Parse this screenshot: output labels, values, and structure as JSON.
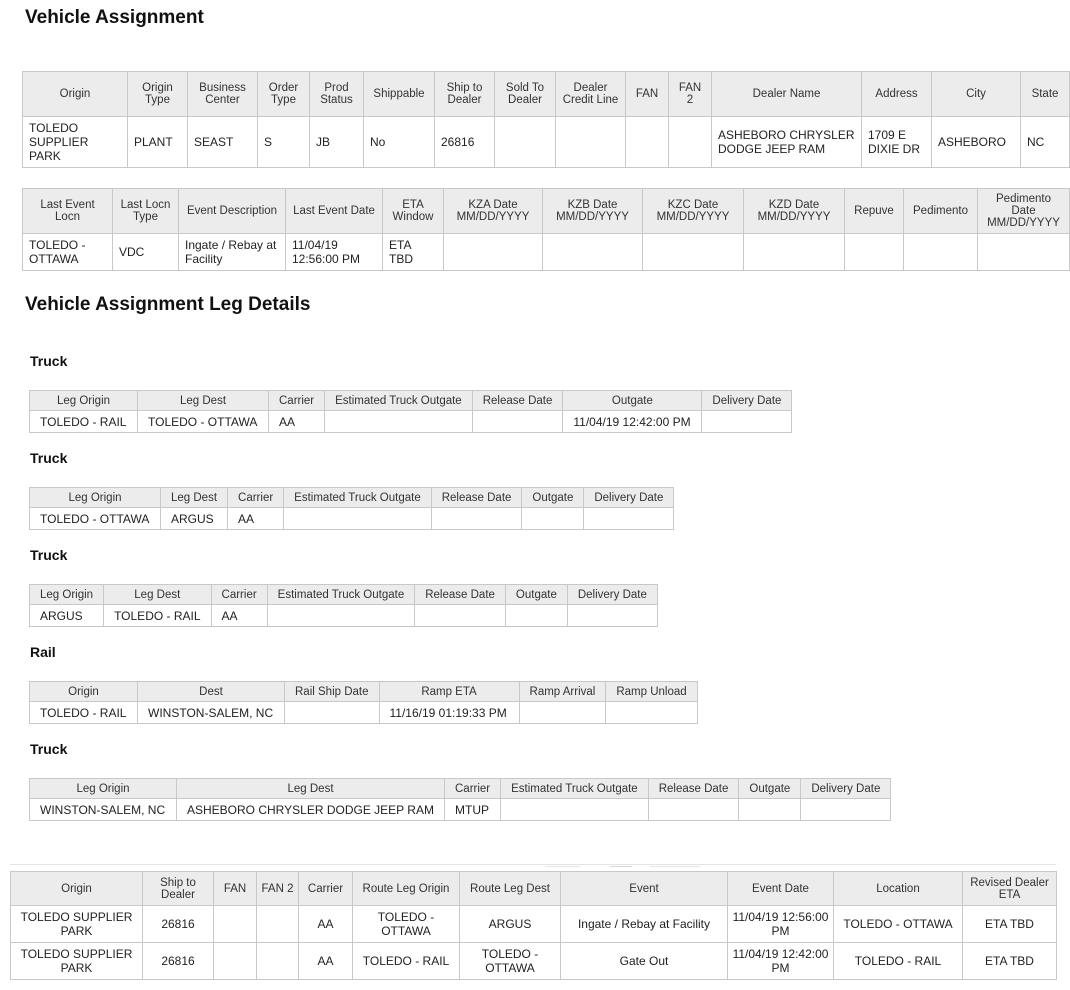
{
  "title": "Vehicle Assignment",
  "assignment": {
    "headers": [
      "Origin",
      "Origin Type",
      "Business Center",
      "Order Type",
      "Prod Status",
      "Shippable",
      "Ship to Dealer",
      "Sold To Dealer",
      "Dealer Credit Line",
      "FAN",
      "FAN 2",
      "Dealer Name",
      "Address",
      "City",
      "State"
    ],
    "row": [
      "TOLEDO SUPPLIER PARK",
      "PLANT",
      "SEAST",
      "S",
      "JB",
      "No",
      "26816",
      "",
      "",
      "",
      "",
      "ASHEBORO CHRYSLER DODGE JEEP RAM",
      "1709 E DIXIE DR",
      "ASHEBORO",
      "NC"
    ]
  },
  "event": {
    "headers": [
      "Last Event Locn",
      "Last Locn Type",
      "Event Description",
      "Last Event Date",
      "ETA Window",
      "KZA Date MM/DD/YYYY",
      "KZB Date MM/DD/YYYY",
      "KZC Date MM/DD/YYYY",
      "KZD Date MM/DD/YYYY",
      "Repuve",
      "Pedimento",
      "Pedimento Date MM/DD/YYYY"
    ],
    "row": [
      "TOLEDO - OTTAWA",
      "VDC",
      "Ingate / Rebay at Facility",
      "11/04/19 12:56:00 PM",
      "ETA TBD",
      "",
      "",
      "",
      "",
      "",
      "",
      ""
    ]
  },
  "legs_title": "Vehicle Assignment Leg Details",
  "legs": [
    {
      "mode": "Truck",
      "headers": [
        "Leg Origin",
        "Leg Dest",
        "Carrier",
        "Estimated Truck Outgate",
        "Release Date",
        "Outgate",
        "Delivery Date"
      ],
      "row": [
        "TOLEDO - RAIL",
        "TOLEDO - OTTAWA",
        "AA",
        "",
        "",
        "11/04/19 12:42:00 PM",
        ""
      ]
    },
    {
      "mode": "Truck",
      "headers": [
        "Leg Origin",
        "Leg Dest",
        "Carrier",
        "Estimated Truck Outgate",
        "Release Date",
        "Outgate",
        "Delivery Date"
      ],
      "row": [
        "TOLEDO - OTTAWA",
        "ARGUS",
        "AA",
        "",
        "",
        "",
        ""
      ]
    },
    {
      "mode": "Truck",
      "headers": [
        "Leg Origin",
        "Leg Dest",
        "Carrier",
        "Estimated Truck Outgate",
        "Release Date",
        "Outgate",
        "Delivery Date"
      ],
      "row": [
        "ARGUS",
        "TOLEDO - RAIL",
        "AA",
        "",
        "",
        "",
        ""
      ]
    },
    {
      "mode": "Rail",
      "headers": [
        "Origin",
        "Dest",
        "Rail Ship Date",
        "Ramp ETA",
        "Ramp Arrival",
        "Ramp Unload"
      ],
      "row": [
        "TOLEDO - RAIL",
        "WINSTON-SALEM, NC",
        "",
        "11/16/19 01:19:33 PM",
        "",
        ""
      ]
    },
    {
      "mode": "Truck",
      "headers": [
        "Leg Origin",
        "Leg Dest",
        "Carrier",
        "Estimated Truck Outgate",
        "Release Date",
        "Outgate",
        "Delivery Date"
      ],
      "row": [
        "WINSTON-SALEM, NC",
        "ASHEBORO CHRYSLER DODGE JEEP RAM",
        "MTUP",
        "",
        "",
        "",
        ""
      ]
    }
  ],
  "history": {
    "headers": [
      "Origin",
      "Ship to Dealer",
      "FAN",
      "FAN 2",
      "Carrier",
      "Route Leg Origin",
      "Route Leg Dest",
      "Event",
      "Event Date",
      "Location",
      "Revised Dealer ETA"
    ],
    "rows": [
      [
        "TOLEDO SUPPLIER PARK",
        "26816",
        "",
        "",
        "AA",
        "TOLEDO - OTTAWA",
        "ARGUS",
        "Ingate / Rebay at Facility",
        "11/04/19 12:56:00 PM",
        "TOLEDO - OTTAWA",
        "ETA TBD"
      ],
      [
        "TOLEDO SUPPLIER PARK",
        "26816",
        "",
        "",
        "AA",
        "TOLEDO - RAIL",
        "TOLEDO - OTTAWA",
        "Gate Out",
        "11/04/19 12:42:00 PM",
        "TOLEDO - RAIL",
        "ETA TBD"
      ]
    ]
  }
}
